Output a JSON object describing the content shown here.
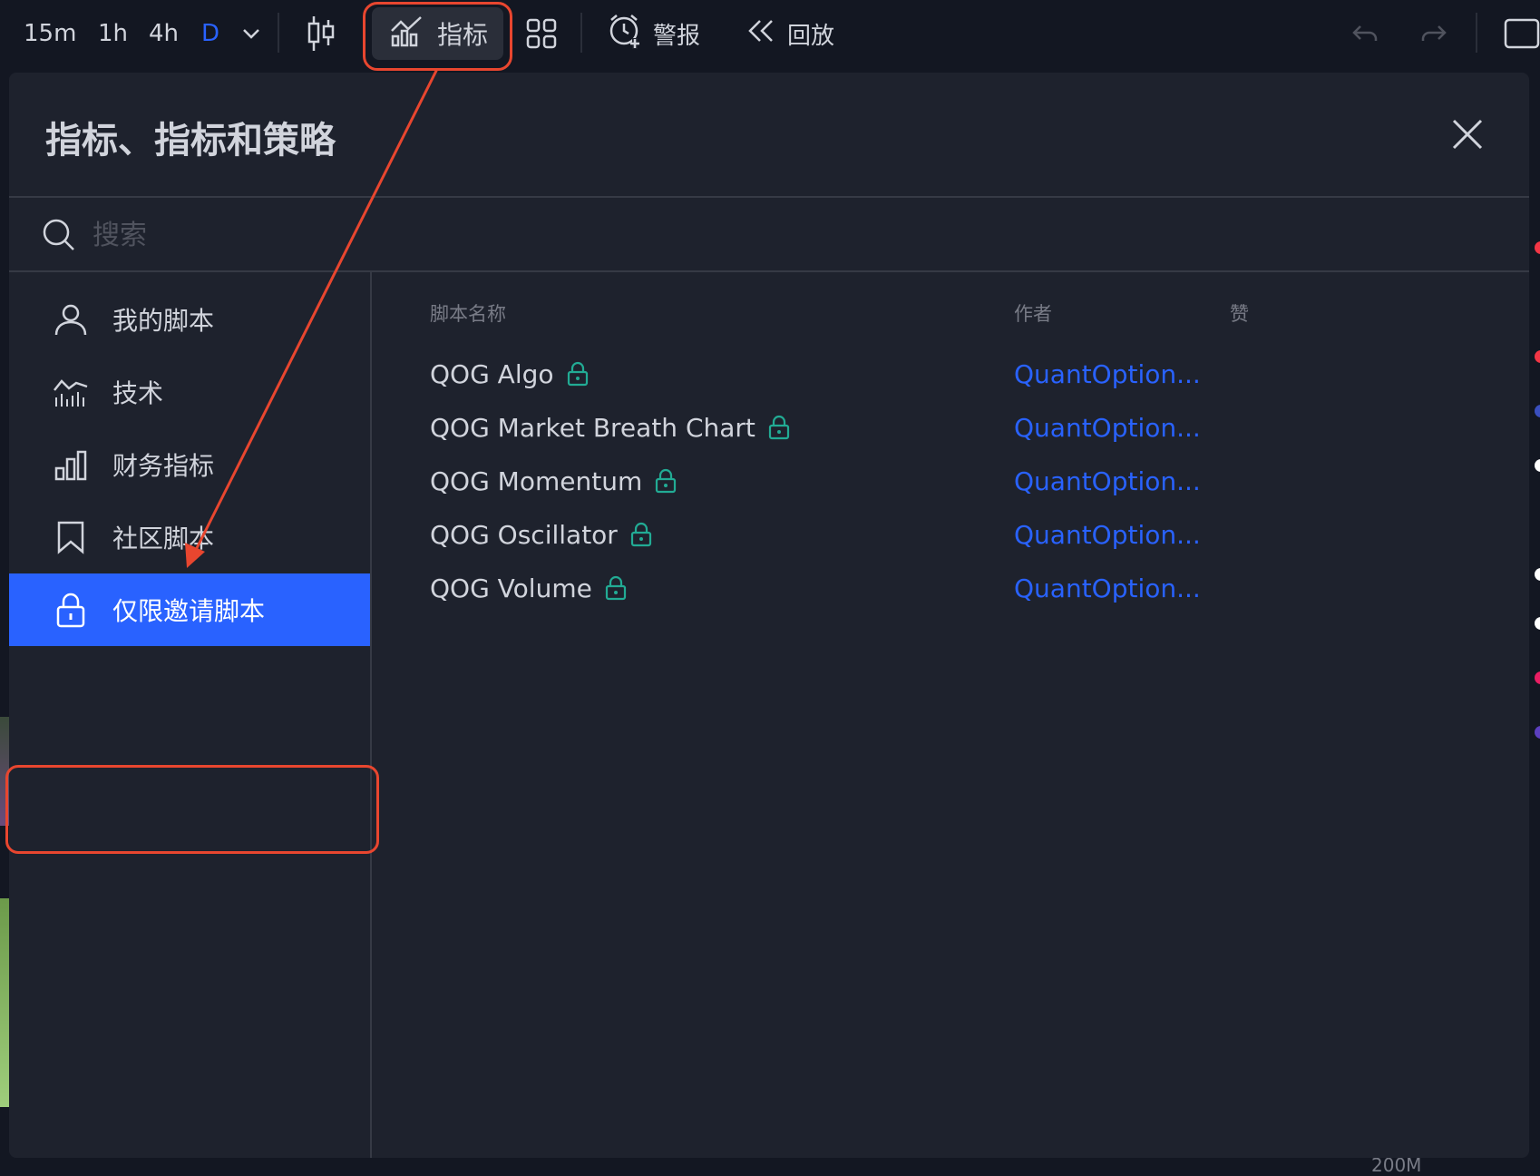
{
  "toolbar": {
    "intervals": [
      "15m",
      "1h",
      "4h",
      "D"
    ],
    "indicators_label": "指标",
    "alert_label": "警报",
    "replay_label": "回放"
  },
  "dialog": {
    "title": "指标、指标和策略",
    "search_placeholder": "搜索",
    "sidebar": [
      {
        "label": "我的脚本",
        "icon": "user-icon"
      },
      {
        "label": "技术",
        "icon": "technical-chart-icon"
      },
      {
        "label": "财务指标",
        "icon": "bar-chart-icon"
      },
      {
        "label": "社区脚本",
        "icon": "bookmark-icon"
      },
      {
        "label": "仅限邀请脚本",
        "icon": "lock-icon",
        "active": true
      }
    ],
    "columns": {
      "name": "脚本名称",
      "author": "作者",
      "likes": "赞"
    },
    "scripts": [
      {
        "name": "QOG Algo",
        "author": "QuantOption..."
      },
      {
        "name": "QOG Market Breath Chart",
        "author": "QuantOption..."
      },
      {
        "name": "QOG Momentum",
        "author": "QuantOption..."
      },
      {
        "name": "QOG Oscillator",
        "author": "QuantOption..."
      },
      {
        "name": "QOG Volume",
        "author": "QuantOption..."
      }
    ]
  },
  "axis_label": "200M",
  "colors": {
    "accent": "#2962ff",
    "annotation": "#e8462f",
    "lock": "#22ab94"
  }
}
